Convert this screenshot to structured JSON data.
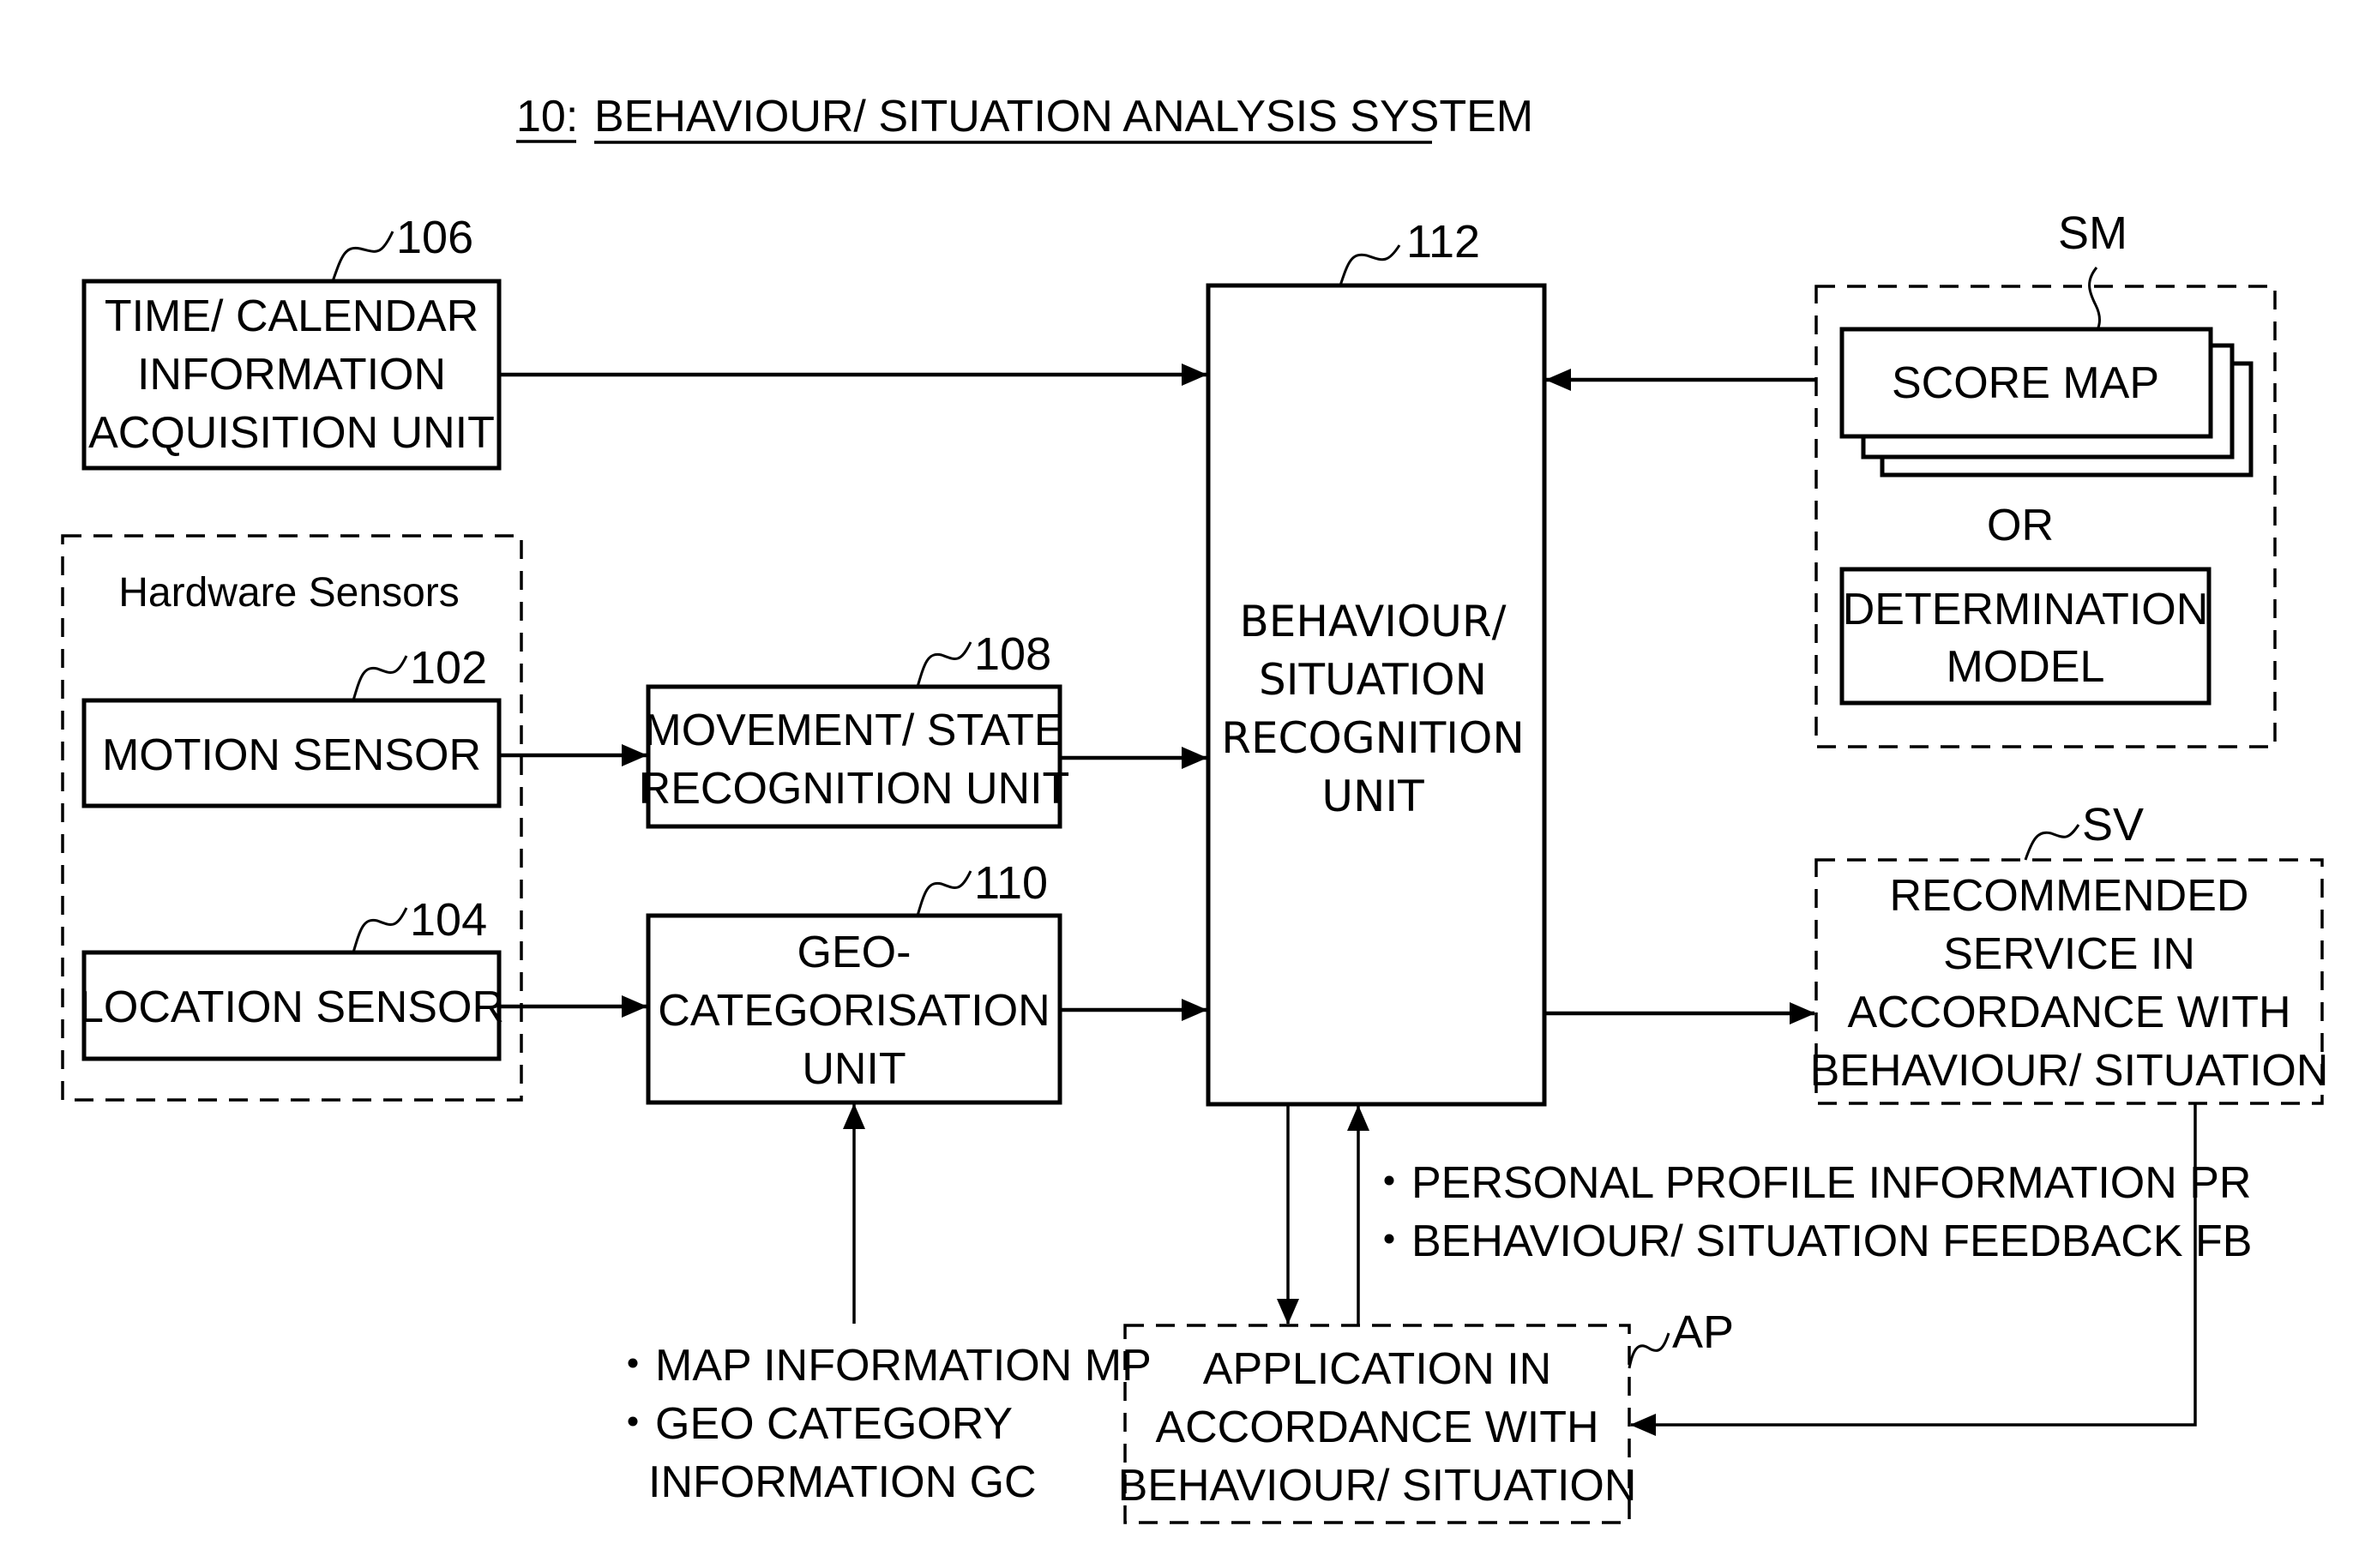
{
  "title": {
    "number": "10:",
    "text": "BEHAVIOUR/ SITUATION ANALYSIS SYSTEM"
  },
  "blocks": {
    "time_calendar": {
      "ref": "106",
      "lines": [
        "TIME/ CALENDAR",
        "INFORMATION",
        "ACQUISITION UNIT"
      ]
    },
    "hardware_sensors": {
      "label": "Hardware Sensors"
    },
    "motion_sensor": {
      "ref": "102",
      "lines": [
        "MOTION SENSOR"
      ]
    },
    "location_sensor": {
      "ref": "104",
      "lines": [
        "LOCATION SENSOR"
      ]
    },
    "movement_state": {
      "ref": "108",
      "lines": [
        "MOVEMENT/ STATE",
        "RECOGNITION UNIT"
      ]
    },
    "geo_categorisation": {
      "ref": "110",
      "lines": [
        "GEO-",
        "CATEGORISATION",
        "UNIT"
      ]
    },
    "recognition_unit": {
      "ref": "112",
      "lines": [
        "BEHAVIOUR/",
        "SITUATION",
        "RECOGNITION",
        "UNIT"
      ]
    },
    "score_map_group": {
      "ref": "SM",
      "score_map": "SCORE MAP",
      "or": "OR",
      "determination_model": [
        "DETERMINATION",
        "MODEL"
      ]
    },
    "recommended_service": {
      "ref": "SV",
      "lines": [
        "RECOMMENDED",
        "SERVICE IN",
        "ACCORDANCE WITH",
        "BEHAVIOUR/ SITUATION"
      ]
    },
    "application": {
      "ref": "AP",
      "lines": [
        "APPLICATION IN",
        "ACCORDANCE WITH",
        "BEHAVIOUR/ SITUATION"
      ]
    }
  },
  "annotations": {
    "map_info": [
      "・MAP INFORMATION MP",
      "・GEO CATEGORY",
      "INFORMATION GC"
    ],
    "profile_feedback": [
      "・PERSONAL PROFILE INFORMATION PR",
      "・BEHAVIOUR/ SITUATION FEEDBACK FB"
    ]
  }
}
